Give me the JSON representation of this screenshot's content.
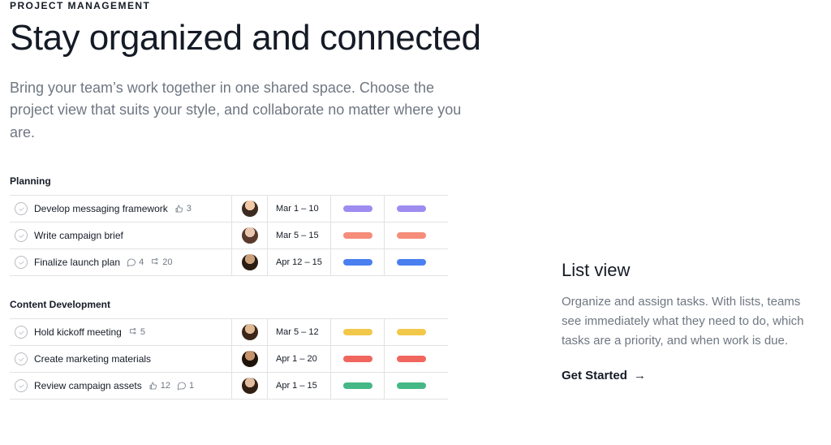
{
  "eyebrow": "PROJECT MANAGEMENT",
  "headline": "Stay organized and connected",
  "subhead": "Bring your team’s work together in one shared space. Choose the project view that suits your style, and collaborate no matter where you are.",
  "sections": [
    {
      "label": "Planning",
      "rows": [
        {
          "title": "Develop messaging framework",
          "likes": 3,
          "comments": null,
          "subtasks": null,
          "avatar": "av1",
          "date": "Mar 1 – 10",
          "color": "#9e8cf0"
        },
        {
          "title": "Write campaign brief",
          "likes": null,
          "comments": null,
          "subtasks": null,
          "avatar": "av2",
          "date": "Mar 5 – 15",
          "color": "#f58d7a"
        },
        {
          "title": "Finalize launch plan",
          "likes": null,
          "comments": 4,
          "subtasks": 20,
          "avatar": "av3",
          "date": "Apr 12 – 15",
          "color": "#4a7ff0"
        }
      ]
    },
    {
      "label": "Content Development",
      "rows": [
        {
          "title": "Hold kickoff meeting",
          "likes": null,
          "comments": null,
          "subtasks": 5,
          "avatar": "av4",
          "date": "Mar 5 – 12",
          "color": "#f2c84b"
        },
        {
          "title": "Create marketing materials",
          "likes": null,
          "comments": null,
          "subtasks": null,
          "avatar": "av5",
          "date": "Apr 1 – 20",
          "color": "#f0665f"
        },
        {
          "title": "Review campaign assets",
          "likes": 12,
          "comments": 1,
          "subtasks": null,
          "avatar": "av6",
          "date": "Apr 1 – 15",
          "color": "#45b886"
        }
      ]
    }
  ],
  "sidebar": {
    "heading": "List view",
    "body": "Organize and assign tasks. With lists, teams see immediately what they need to do, which tasks are a priority, and when work is due.",
    "cta_label": "Get Started",
    "cta_arrow": "→"
  }
}
